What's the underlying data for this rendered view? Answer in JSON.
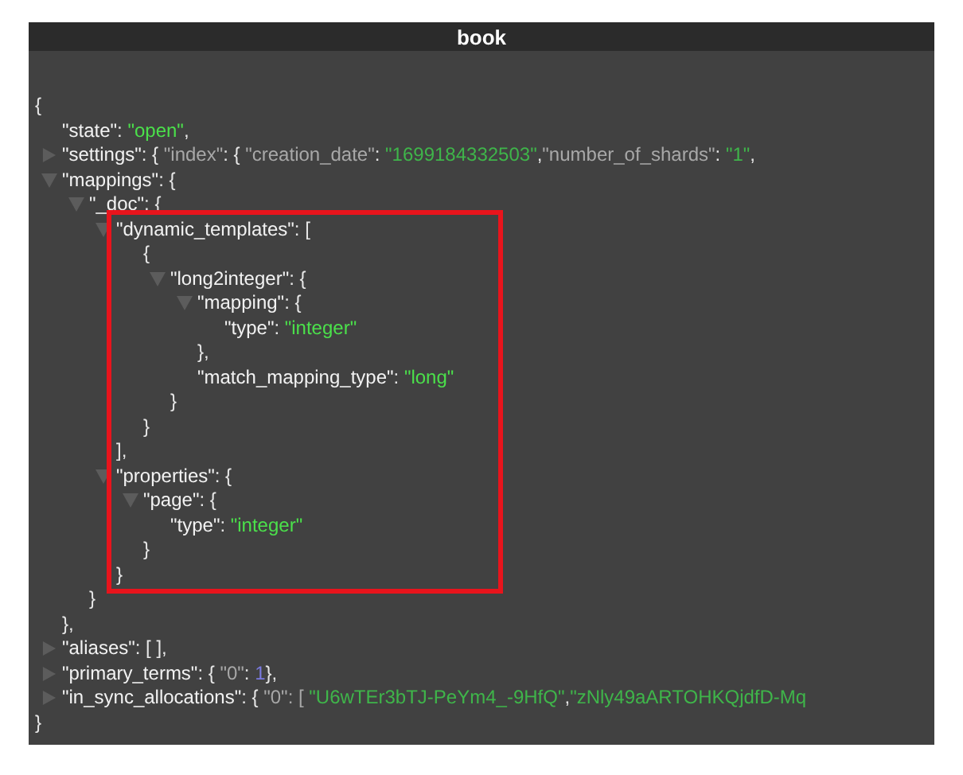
{
  "window": {
    "title": "book"
  },
  "document": {
    "segments": [
      {
        "t": "{",
        "kind": "punct"
      }
    ],
    "close": "}",
    "children": [
      {
        "segments": [
          {
            "t": "\"state\"",
            "kind": "key"
          },
          {
            "t": ": ",
            "kind": "punct"
          },
          {
            "t": "\"open\"",
            "kind": "str"
          },
          {
            "t": ",",
            "kind": "punct"
          }
        ]
      },
      {
        "expanded": false,
        "segments": [
          {
            "t": "\"settings\"",
            "kind": "key"
          },
          {
            "t": ": { ",
            "kind": "punct"
          },
          {
            "t": "\"index\"",
            "kind": "dkey"
          },
          {
            "t": ": { ",
            "kind": "punct"
          },
          {
            "t": "\"creation_date\"",
            "kind": "dkey"
          },
          {
            "t": ": ",
            "kind": "punct"
          },
          {
            "t": "\"1699184332503\"",
            "kind": "dstr"
          },
          {
            "t": ",",
            "kind": "punct"
          },
          {
            "t": "\"number_of_shards\"",
            "kind": "dkey"
          },
          {
            "t": ": ",
            "kind": "punct"
          },
          {
            "t": "\"1\"",
            "kind": "dstr"
          },
          {
            "t": ",",
            "kind": "punct"
          }
        ]
      },
      {
        "expanded": true,
        "segments": [
          {
            "t": "\"mappings\"",
            "kind": "key"
          },
          {
            "t": ": {",
            "kind": "punct"
          }
        ],
        "close": "},",
        "children": [
          {
            "expanded": true,
            "segments": [
              {
                "t": "\"_doc\"",
                "kind": "key"
              },
              {
                "t": ": {",
                "kind": "punct"
              }
            ],
            "close": "}",
            "children": [
              {
                "expanded": true,
                "segments": [
                  {
                    "t": "\"dynamic_templates\"",
                    "kind": "key"
                  },
                  {
                    "t": ": [",
                    "kind": "punct"
                  }
                ],
                "close": "],",
                "children": [
                  {
                    "segments": [
                      {
                        "t": "{",
                        "kind": "punct"
                      }
                    ],
                    "close": "}",
                    "children": [
                      {
                        "expanded": true,
                        "segments": [
                          {
                            "t": "\"long2integer\"",
                            "kind": "key"
                          },
                          {
                            "t": ": {",
                            "kind": "punct"
                          }
                        ],
                        "close": "}",
                        "children": [
                          {
                            "expanded": true,
                            "segments": [
                              {
                                "t": "\"mapping\"",
                                "kind": "key"
                              },
                              {
                                "t": ": {",
                                "kind": "punct"
                              }
                            ],
                            "close": "},",
                            "children": [
                              {
                                "segments": [
                                  {
                                    "t": "\"type\"",
                                    "kind": "key"
                                  },
                                  {
                                    "t": ": ",
                                    "kind": "punct"
                                  },
                                  {
                                    "t": "\"integer\"",
                                    "kind": "str"
                                  }
                                ]
                              }
                            ]
                          },
                          {
                            "segments": [
                              {
                                "t": "\"match_mapping_type\"",
                                "kind": "key"
                              },
                              {
                                "t": ": ",
                                "kind": "punct"
                              },
                              {
                                "t": "\"long\"",
                                "kind": "str"
                              }
                            ]
                          }
                        ]
                      }
                    ]
                  }
                ]
              },
              {
                "expanded": true,
                "segments": [
                  {
                    "t": "\"properties\"",
                    "kind": "key"
                  },
                  {
                    "t": ": {",
                    "kind": "punct"
                  }
                ],
                "close": "}",
                "children": [
                  {
                    "expanded": true,
                    "segments": [
                      {
                        "t": "\"page\"",
                        "kind": "key"
                      },
                      {
                        "t": ": {",
                        "kind": "punct"
                      }
                    ],
                    "close": "}",
                    "children": [
                      {
                        "segments": [
                          {
                            "t": "\"type\"",
                            "kind": "key"
                          },
                          {
                            "t": ": ",
                            "kind": "punct"
                          },
                          {
                            "t": "\"integer\"",
                            "kind": "str"
                          }
                        ]
                      }
                    ]
                  }
                ]
              }
            ]
          }
        ]
      },
      {
        "expanded": false,
        "segments": [
          {
            "t": "\"aliases\"",
            "kind": "key"
          },
          {
            "t": ": [ ],",
            "kind": "punct"
          }
        ]
      },
      {
        "expanded": false,
        "segments": [
          {
            "t": "\"primary_terms\"",
            "kind": "key"
          },
          {
            "t": ": { ",
            "kind": "punct"
          },
          {
            "t": "\"0\"",
            "kind": "dkey"
          },
          {
            "t": ": ",
            "kind": "punct"
          },
          {
            "t": "1",
            "kind": "num"
          },
          {
            "t": "},",
            "kind": "punct"
          }
        ]
      },
      {
        "expanded": false,
        "segments": [
          {
            "t": "\"in_sync_allocations\"",
            "kind": "key"
          },
          {
            "t": ": { ",
            "kind": "punct"
          },
          {
            "t": "\"0\"",
            "kind": "dkey"
          },
          {
            "t": ": [ ",
            "kind": "dkey"
          },
          {
            "t": "\"U6wTEr3bTJ-PeYm4_-9HfQ\"",
            "kind": "dstr"
          },
          {
            "t": ",",
            "kind": "punct"
          },
          {
            "t": "\"zNly49aARTOHKQjdfD-Mq",
            "kind": "dstr"
          }
        ]
      }
    ]
  }
}
